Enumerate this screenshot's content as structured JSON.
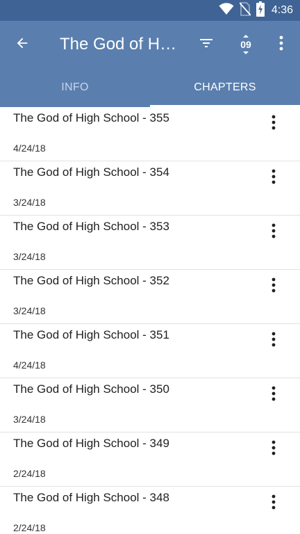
{
  "status_bar": {
    "time": "4:36",
    "icons": [
      "wifi-icon",
      "no-sim-icon",
      "battery-charging-icon"
    ]
  },
  "app_bar": {
    "title": "The God of High School",
    "back_icon": "arrow-left-icon",
    "actions": [
      "filter-icon",
      "sort-numeric-icon",
      "more-vert-icon"
    ],
    "sort_label": "09",
    "color": "#5a7fae"
  },
  "tabs": [
    {
      "label": "INFO",
      "selected": false
    },
    {
      "label": "CHAPTERS",
      "selected": true
    }
  ],
  "chapters": [
    {
      "title": "The God of High School - 355",
      "date": "4/24/18"
    },
    {
      "title": "The God of High School - 354",
      "date": "3/24/18"
    },
    {
      "title": "The God of High School - 353",
      "date": "3/24/18"
    },
    {
      "title": "The God of High School - 352",
      "date": "3/24/18"
    },
    {
      "title": "The God of High School - 351",
      "date": "4/24/18"
    },
    {
      "title": "The God of High School - 350",
      "date": "3/24/18"
    },
    {
      "title": "The God of High School - 349",
      "date": "2/24/18"
    },
    {
      "title": "The God of High School - 348",
      "date": "2/24/18"
    }
  ]
}
